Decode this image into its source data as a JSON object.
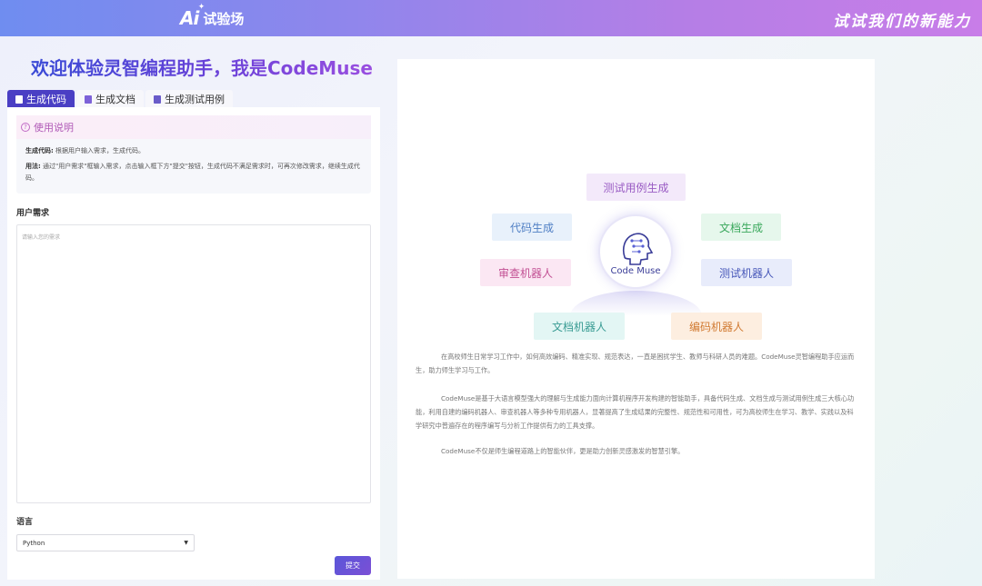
{
  "header": {
    "logo_ai": "Ai",
    "logo_name": "试验场",
    "slogan": "试试我们的新能力"
  },
  "headline": "欢迎体验灵智编程助手，我是CodeMuse",
  "tabs": [
    {
      "label": "生成代码",
      "active": true
    },
    {
      "label": "生成文档",
      "active": false
    },
    {
      "label": "生成测试用例",
      "active": false
    }
  ],
  "help": {
    "title": "使用说明",
    "line1_label": "生成代码:",
    "line1_text": "根据用户输入需求，生成代码。",
    "line2_label": "用法:",
    "line2_text": "通过\"用户需求\"框输入需求，点击输入框下方\"提交\"按钮，生成代码不满足需求时，可再次修改需求，继续生成代码。"
  },
  "form": {
    "requirement_label": "用户需求",
    "requirement_placeholder": "请输入您的需求",
    "language_label": "语言",
    "language_value": "Python",
    "submit_label": "提交"
  },
  "diagram": {
    "hub_label": "Code Muse",
    "nodes": [
      {
        "id": "test-case",
        "label": "测试用例生成",
        "bg": "#f3e9fa",
        "color": "#9a5cc4"
      },
      {
        "id": "code-gen",
        "label": "代码生成",
        "bg": "#e8f1fb",
        "color": "#4f7fc4"
      },
      {
        "id": "doc-gen",
        "label": "文档生成",
        "bg": "#e6f7ec",
        "color": "#3aa85c"
      },
      {
        "id": "review-bot",
        "label": "审查机器人",
        "bg": "#fbe7f3",
        "color": "#c24f93"
      },
      {
        "id": "test-bot",
        "label": "测试机器人",
        "bg": "#e8ecfb",
        "color": "#4757b9"
      },
      {
        "id": "doc-bot",
        "label": "文档机器人",
        "bg": "#e3f6f4",
        "color": "#3a9c94"
      },
      {
        "id": "code-bot",
        "label": "编码机器人",
        "bg": "#fdeee0",
        "color": "#d17b33"
      }
    ]
  },
  "description": {
    "p1": "在高校师生日常学习工作中，如何高效编码、精准实现、规范表达，一直是困扰学生、教师与科研人员的难题。CodeMuse灵智编程助手应运而生，助力师生学习与工作。",
    "p2": "CodeMuse是基于大语言模型强大的理解与生成能力面向计算机程序开发构建的智能助手，具备代码生成、文档生成与测试用例生成三大核心功能，利用自建的编码机器人、审查机器人等多种专用机器人，显著提高了生成结果的完整性、规范性和可用性，可为高校师生在学习、教学、实践以及科学研究中普遍存在的程序编写与分析工作提供有力的工具支撑。",
    "p3": "CodeMuse不仅是师生编程道路上的智能伙伴，更是助力创新灵感激发的智慧引擎。"
  }
}
